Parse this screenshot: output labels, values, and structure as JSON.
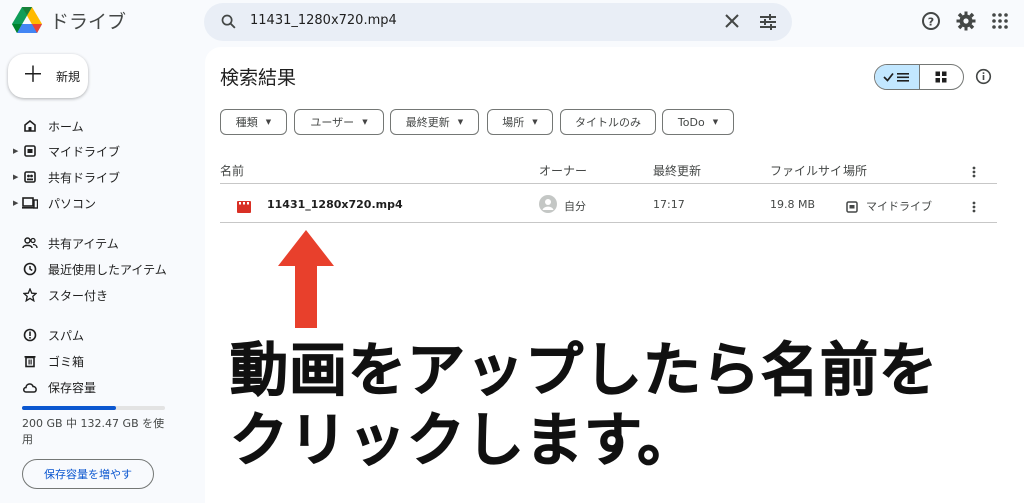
{
  "app": {
    "title": "ドライブ"
  },
  "search": {
    "value": "11431_1280x720.mp4"
  },
  "sidebar": {
    "new_label": "新規",
    "items": [
      {
        "label": "ホーム",
        "icon": "home-icon"
      },
      {
        "label": "マイドライブ",
        "icon": "my-drive-icon"
      },
      {
        "label": "共有ドライブ",
        "icon": "shared-drive-icon"
      },
      {
        "label": "パソコン",
        "icon": "computer-icon"
      },
      {
        "label": "共有アイテム",
        "icon": "people-icon"
      },
      {
        "label": "最近使用したアイテム",
        "icon": "clock-icon"
      },
      {
        "label": "スター付き",
        "icon": "star-icon"
      },
      {
        "label": "スパム",
        "icon": "spam-icon"
      },
      {
        "label": "ゴミ箱",
        "icon": "trash-icon"
      },
      {
        "label": "保存容量",
        "icon": "cloud-icon"
      }
    ],
    "storage_text": "200 GB 中 132.47 GB を使用",
    "storage_fraction": 0.66,
    "storage_button": "保存容量を増やす"
  },
  "main": {
    "title": "検索結果",
    "chips": [
      "種類",
      "ユーザー",
      "最終更新",
      "場所",
      "タイトルのみ",
      "ToDo"
    ],
    "columns": {
      "name": "名前",
      "owner": "オーナー",
      "modified": "最終更新",
      "size": "ファイルサイ",
      "location": "場所"
    },
    "rows": [
      {
        "name": "11431_1280x720.mp4",
        "owner": "自分",
        "modified": "17:17",
        "size": "19.8 MB",
        "location": "マイドライブ"
      }
    ]
  },
  "annotation": {
    "line1": "動画をアップしたら名前を",
    "line2": "クリックします。"
  },
  "colors": {
    "accent": "#0b57d0",
    "arrow": "#e8402c",
    "video": "#d93025",
    "toggle_on": "#c2e7ff"
  }
}
